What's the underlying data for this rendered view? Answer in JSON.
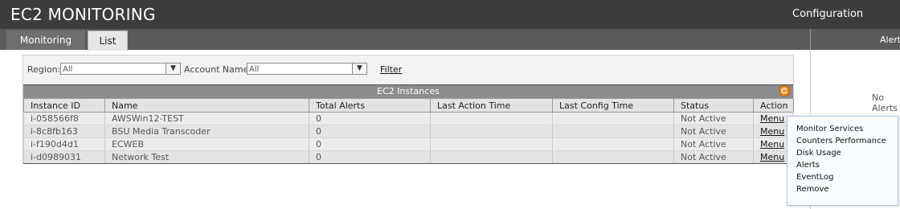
{
  "app": {
    "title": "EC2 MONITORING",
    "config_label": "Configuration"
  },
  "tabs": [
    {
      "label": "Monitoring",
      "active": false
    },
    {
      "label": "List",
      "active": true
    }
  ],
  "right_panel": {
    "title": "Alerts",
    "empty_text": "No Alerts"
  },
  "filters": {
    "region_label": "Region:",
    "region_value": "All",
    "account_label": "Account Name:",
    "account_value": "All",
    "filter_label": "Filter"
  },
  "grid": {
    "title": "EC2 Instances",
    "columns": [
      "Instance ID",
      "Name",
      "Total Alerts",
      "Last Action Time",
      "Last Config Time",
      "Status",
      "Action"
    ],
    "rows": [
      {
        "id": "i-058566f8",
        "name": "AWSWin12-TEST",
        "alerts": "0",
        "last_action": "",
        "last_config": "",
        "status": "Not Active",
        "action": "Menu"
      },
      {
        "id": "i-8c8fb163",
        "name": "BSU Media Transcoder",
        "alerts": "0",
        "last_action": "",
        "last_config": "",
        "status": "Not Active",
        "action": "Menu"
      },
      {
        "id": "i-f190d4d1",
        "name": "ECWEB",
        "alerts": "0",
        "last_action": "",
        "last_config": "",
        "status": "Not Active",
        "action": "Menu"
      },
      {
        "id": "i-d0989031",
        "name": "Network Test",
        "alerts": "0",
        "last_action": "",
        "last_config": "",
        "status": "Not Active",
        "action": "Menu"
      }
    ]
  },
  "context_menu": {
    "items": [
      "Monitor Services",
      "Counters Performance",
      "Disk Usage",
      "Alerts",
      "EventLog",
      "Remove"
    ]
  },
  "colors": {
    "topbar": "#3c3c3c",
    "tabbar": "#5a5a5a",
    "refresh_accent": "#f08a1c"
  },
  "icons": {
    "refresh": "refresh-icon",
    "dropdown": "chevron-down-icon"
  }
}
